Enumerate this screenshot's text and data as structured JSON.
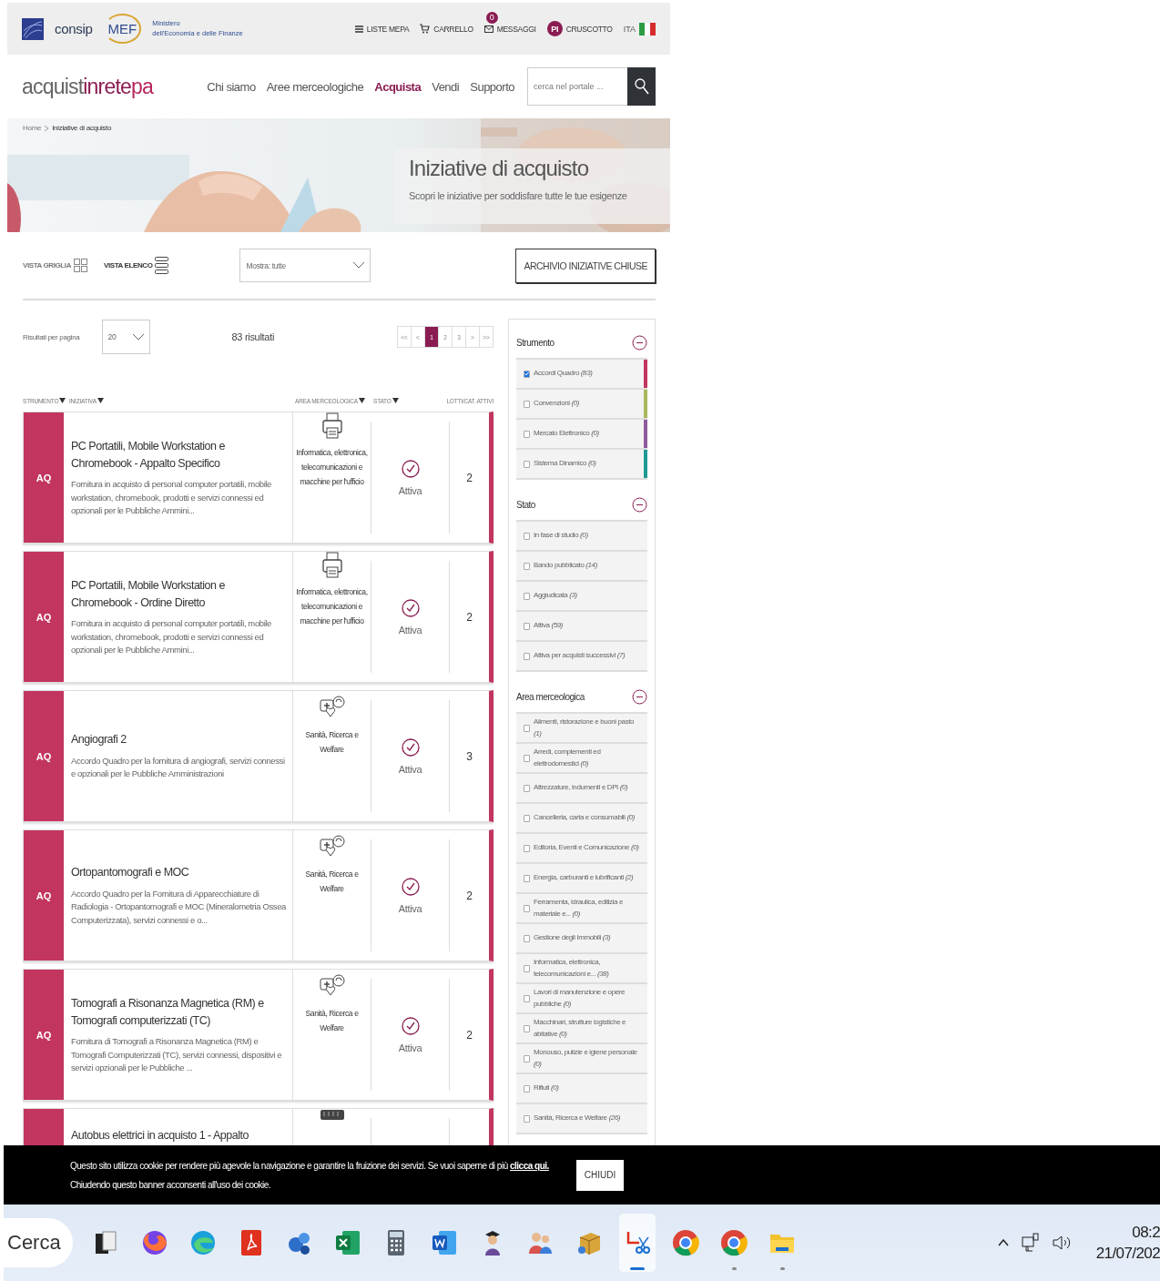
{
  "header": {
    "brand": "consip",
    "ministry_logo": "MEF",
    "ministry_lines": [
      "Ministero",
      "dell'Economia e delle Finanze"
    ],
    "top_links": [
      {
        "kind": "list",
        "label": "LISTE MEPA"
      },
      {
        "kind": "cart",
        "label": "CARRELLO"
      },
      {
        "kind": "mail",
        "label": "MESSAGGI",
        "badge": "0"
      },
      {
        "kind": "avatar",
        "initials": "PI",
        "label": "CRUSCOTTO"
      }
    ],
    "language": "ITA"
  },
  "nav": {
    "logo_parts": [
      "acquist",
      "inrete",
      "pa"
    ],
    "items": [
      {
        "label": "Chi siamo",
        "selected": false
      },
      {
        "label": "Aree merceologiche",
        "selected": false
      },
      {
        "label": "Acquista",
        "selected": true
      },
      {
        "label": "Vendi",
        "selected": false
      },
      {
        "label": "Supporto",
        "selected": false
      }
    ],
    "search": {
      "placeholder": "cerca nel portale ..."
    }
  },
  "hero": {
    "breadcrumb": [
      "Home",
      "Iniziative di acquisto"
    ],
    "title": "Iniziative di acquisto",
    "subtitle": "Scopri le iniziative per soddisfare tutte le tue esigenze"
  },
  "toolbar": {
    "views": [
      {
        "kind": "grid",
        "label": "VISTA GRIGLIA",
        "selected": false
      },
      {
        "kind": "list",
        "label": "VISTA ELENCO",
        "selected": true
      }
    ],
    "filter": {
      "value": "Mostra: tutte"
    },
    "archive_button": "ARCHIVIO INIZIATIVE CHIUSE"
  },
  "results": {
    "per_page_label": "Risultati per pagina",
    "per_page": "20",
    "count": "83 risultati",
    "pages": [
      {
        "label": "<<",
        "selected": false
      },
      {
        "label": "<",
        "selected": false
      },
      {
        "label": "1",
        "selected": true
      },
      {
        "label": "2",
        "selected": false
      },
      {
        "label": "3",
        "selected": false
      },
      {
        "label": ">",
        "selected": false
      },
      {
        "label": ">>",
        "selected": false
      }
    ]
  },
  "columns": [
    {
      "label": "STRUMENTO",
      "sortable": true
    },
    {
      "label": "INIZIATIVA",
      "sortable": true
    },
    {
      "label": "AREA MERCEOLOGICA",
      "sortable": true
    },
    {
      "label": "STATO",
      "sortable": true
    },
    {
      "label": "LOTTI/CAT. ATTIVI",
      "sortable": false
    }
  ],
  "cards": [
    {
      "tag": "AQ",
      "title": "PC Portatili, Mobile Workstation e Chromebook - Appalto Specifico",
      "description": "Fornitura in acquisto di personal computer portatili, mobile workstation, chromebook, prodotti e servizi connessi ed opzionali per le Pubbliche Ammini...",
      "kind": "printer",
      "area": "Informatica, elettronica, telecomunicazioni e macchine per l'ufficio",
      "status": "Attiva",
      "count": "2"
    },
    {
      "tag": "AQ",
      "title": "PC Portatili, Mobile Workstation e Chromebook - Ordine Diretto",
      "description": "Fornitura in acquisto di personal computer portatili, mobile workstation, chromebook, prodotti e servizi connessi ed opzionali per le Pubbliche Ammini...",
      "kind": "printer",
      "area": "Informatica, elettronica, telecomunicazioni e macchine per l'ufficio",
      "status": "Attiva",
      "count": "2"
    },
    {
      "tag": "AQ",
      "title": "Angiografi 2",
      "description": "Accordo Quadro per la fornitura di angiografi, servizi connessi e opzionali per le Pubbliche Amministrazioni",
      "kind": "health",
      "area": "Sanità, Ricerca e Welfare",
      "status": "Attiva",
      "count": "3"
    },
    {
      "tag": "AQ",
      "title": "Ortopantomografi e MOC",
      "description": "Accordo Quadro per la Fornitura di Apparecchiature di Radiologia -  Ortopantomografi e MOC (Mineralometria Ossea Computerizzata), servizi connessi e o...",
      "kind": "health",
      "area": "Sanità, Ricerca e Welfare",
      "status": "Attiva",
      "count": "2"
    },
    {
      "tag": "AQ",
      "title": "Tomografi a Risonanza Magnetica (RM) e Tomografi computerizzati (TC)",
      "description": "Fornitura di Tomografi a Risonanza Magnetica (RM) e Tomografi Computerizzati (TC), servizi connessi, dispositivi e servizi opzionali per le Pubbliche ...",
      "kind": "health",
      "area": "Sanità, Ricerca e Welfare",
      "status": "Attiva",
      "count": "2"
    },
    {
      "title": "Autobus elettrici in acquisto 1 - Appalto",
      "kind": "bus"
    }
  ],
  "filters": [
    {
      "title": "Strumento",
      "items": [
        {
          "label": "Accordi Quadro *(83)*",
          "checked": true,
          "color": "#c2355f"
        },
        {
          "label": "Convenzioni *(0)*",
          "checked": false,
          "color": "#a9b95a"
        },
        {
          "label": "Mercato Elettronico *(0)*",
          "checked": false,
          "color": "#8e5b9e"
        },
        {
          "label": "Sistema Dinamico *(0)*",
          "checked": false,
          "color": "#1f9a95"
        }
      ]
    },
    {
      "title": "Stato",
      "items": [
        {
          "label": "In fase di studio *(0)*",
          "checked": false
        },
        {
          "label": "Bando pubblicato *(14)*",
          "checked": false
        },
        {
          "label": "Aggiudicata *(3)*",
          "checked": false
        },
        {
          "label": "Attiva *(59)*",
          "checked": false
        },
        {
          "label": "Attiva per acquisti successivi *(7)*",
          "checked": false
        }
      ]
    },
    {
      "title": "Area merceologica",
      "items": [
        {
          "label": "Alimenti, ristorazione e buoni pasto *(1)*",
          "checked": false
        },
        {
          "label": "Arredi, complementi ed elettrodomestici *(0)*",
          "checked": false
        },
        {
          "label": "Attrezzature, indumenti e DPI *(0)*",
          "checked": false
        },
        {
          "label": "Cancelleria, carta e consumabili *(0)*",
          "checked": false
        },
        {
          "label": "Editoria, Eventi e Comunicazione *(0)*",
          "checked": false
        },
        {
          "label": "Energia, carburanti e lubrificanti *(2)*",
          "checked": false
        },
        {
          "label": "Ferramenta, idraulica, edilizia e materiale e... *(0)*",
          "checked": false
        },
        {
          "label": "Gestione degli Immobili *(3)*",
          "checked": false
        },
        {
          "label": "Informatica, elettronica, telecomunicazioni e... *(38)*",
          "checked": false
        },
        {
          "label": "Lavori di manutenzione e opere pubbliche *(0)*",
          "checked": false
        },
        {
          "label": "Macchinari, strutture logistiche e abitative *(0)*",
          "checked": false
        },
        {
          "label": "Monouso, pulizie e igiene personale *(0)*",
          "checked": false
        },
        {
          "label": "Rifiuti *(0)*",
          "checked": false
        },
        {
          "label": "Sanità, Ricerca e Welfare *(26)*",
          "checked": false
        }
      ]
    }
  ],
  "cookie_banner": {
    "text": "Questo sito utilizza cookie per rendere più agevole la navigazione e garantire la fruizione dei servizi. Se vuoi saperne di più",
    "link": "clicca qui.",
    "text_2": "Chiudendo questo banner acconsenti all'uso dei cookie.",
    "button": "CHIUDI"
  },
  "taskbar": {
    "search": "Cerca",
    "apps": [
      {
        "kind": "document",
        "active": false,
        "running": false
      },
      {
        "kind": "fox",
        "active": false,
        "running": false
      },
      {
        "kind": "wave",
        "active": false,
        "running": false
      },
      {
        "kind": "pdf",
        "active": false,
        "running": false
      },
      {
        "kind": "cloud",
        "active": false,
        "running": false
      },
      {
        "kind": "sheet",
        "active": false,
        "running": false
      },
      {
        "kind": "calculator",
        "active": false,
        "running": false
      },
      {
        "kind": "word",
        "active": false,
        "running": false
      },
      {
        "kind": "graduate",
        "active": false,
        "running": false
      },
      {
        "kind": "people",
        "active": false,
        "running": false
      },
      {
        "kind": "package",
        "active": false,
        "running": false
      },
      {
        "kind": "scissors",
        "active": true,
        "running": true
      },
      {
        "kind": "ring",
        "active": false,
        "running": false
      },
      {
        "kind": "ring",
        "active": false,
        "running": true
      },
      {
        "kind": "folder",
        "active": false,
        "running": true
      }
    ],
    "time": "08:2",
    "date": "21/07/202"
  }
}
